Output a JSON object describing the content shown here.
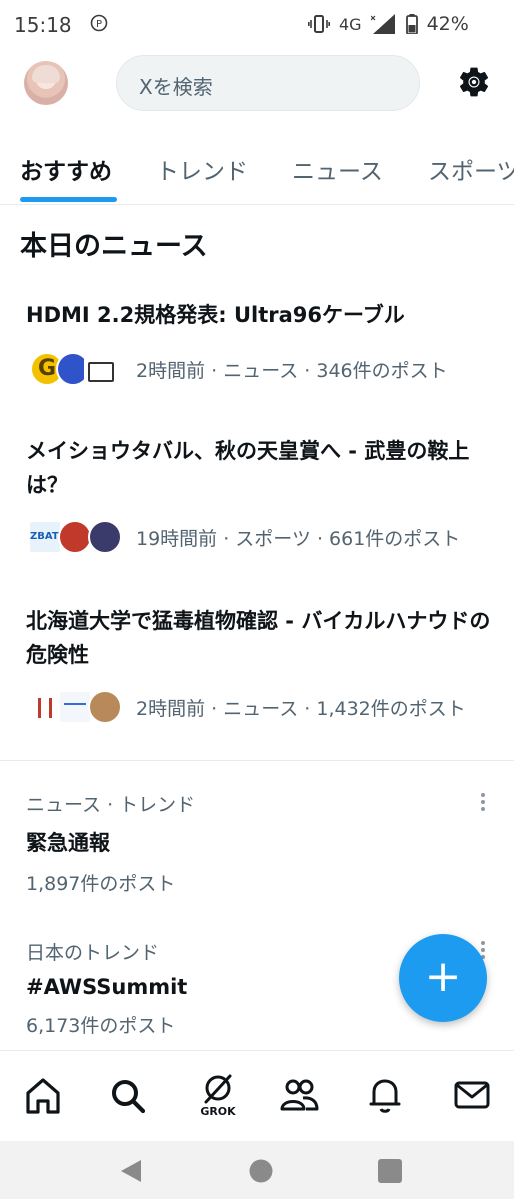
{
  "status_bar": {
    "time": "15:18",
    "network": "4G",
    "battery": "42%"
  },
  "header": {
    "search_placeholder": "Xを検索"
  },
  "tabs": [
    {
      "label": "おすすめ",
      "active": true
    },
    {
      "label": "トレンド",
      "active": false
    },
    {
      "label": "ニュース",
      "active": false
    },
    {
      "label": "スポーツ",
      "active": false
    }
  ],
  "section_title": "本日のニュース",
  "news": [
    {
      "headline": "HDMI 2.2規格発表: Ultra96ケーブル",
      "meta": "2時間前 · ニュース · 346件のポスト"
    },
    {
      "headline": "メイショウタバル、秋の天皇賞へ - 武豊の鞍上は？",
      "meta": "19時間前 · スポーツ · 661件のポスト"
    },
    {
      "headline": "北海道大学で猛毒植物確認 - バイカルハナウドの危険性",
      "meta": "2時間前 · ニュース · 1,432件のポスト"
    }
  ],
  "trends": [
    {
      "context": "ニュース · トレンド",
      "name": "緊急通報",
      "count": "1,897件のポスト"
    },
    {
      "context": "日本のトレンド",
      "name": "#AWSSummit",
      "count": "6,173件のポスト"
    }
  ],
  "fab": {
    "label": "+"
  },
  "bottom_nav": {
    "grok_label": "GROK"
  },
  "colors": {
    "accent": "#1d9bf0",
    "text": "#0f1419",
    "secondary": "#536471"
  }
}
